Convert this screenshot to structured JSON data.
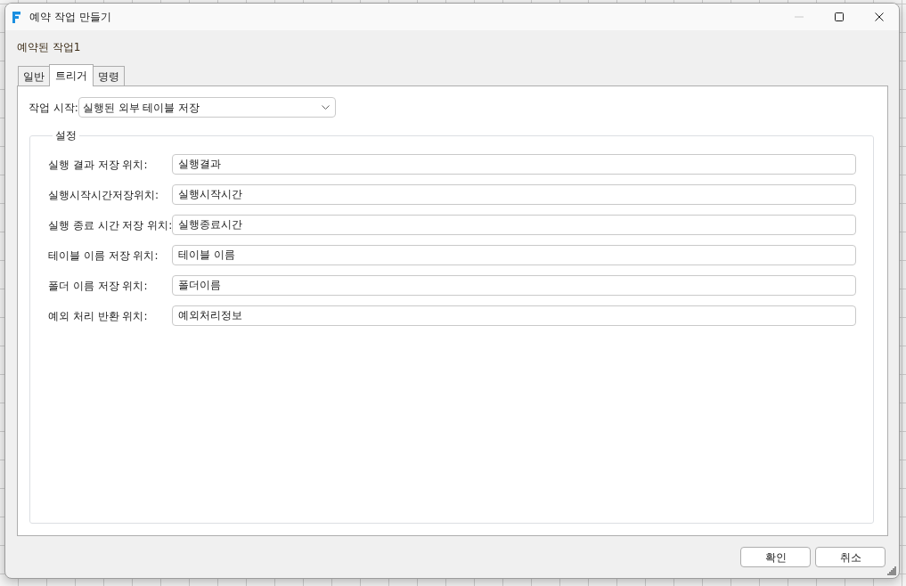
{
  "window": {
    "title": "예약 작업 만들기",
    "controls": [
      {
        "kind": "minimize",
        "disabled": true
      },
      {
        "kind": "maximize",
        "disabled": false
      },
      {
        "kind": "close",
        "disabled": false
      }
    ]
  },
  "task_name": "예약된 작업1",
  "tabs": [
    {
      "label": "일반",
      "selected": false
    },
    {
      "label": "트리거",
      "selected": true
    },
    {
      "label": "명령",
      "selected": false
    }
  ],
  "trigger": {
    "label": "작업 시작:",
    "value": "실행된 외부 테이블 저장"
  },
  "settings": {
    "title": "설정",
    "fields": [
      {
        "label": "실행 결과 저장 위치:",
        "value": "실행결과"
      },
      {
        "label": "실행시작시간저장위치:",
        "value": "실행시작시간"
      },
      {
        "label": "실행 종료 시간 저장 위치:",
        "value": "실행종료시간"
      },
      {
        "label": "테이블 이름 저장 위치:",
        "value": "테이블 이름"
      },
      {
        "label": "폴더 이름 저장 위치:",
        "value": "폴더이름"
      },
      {
        "label": "예외 처리 반환 위치:",
        "value": "예외처리정보"
      }
    ]
  },
  "buttons": [
    {
      "label": "확인"
    },
    {
      "label": "취소"
    }
  ]
}
